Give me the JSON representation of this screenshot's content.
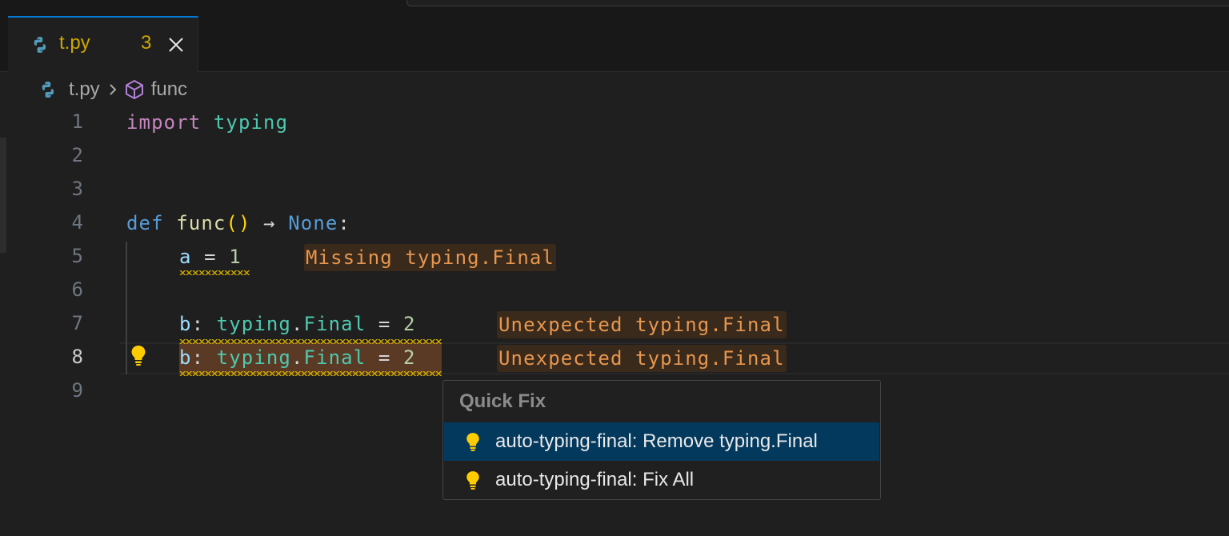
{
  "tab": {
    "filename": "t.py",
    "problem_count": "3"
  },
  "breadcrumb": {
    "file": "t.py",
    "symbol": "func"
  },
  "gutter": {
    "lines": [
      "1",
      "2",
      "3",
      "4",
      "5",
      "6",
      "7",
      "8",
      "9"
    ],
    "active_line": "8"
  },
  "code": {
    "line1": {
      "kw": "import",
      "module": "typing"
    },
    "line4": {
      "kw": "def",
      "name": "func",
      "parens": "()",
      "arrow": "→",
      "ret": "None",
      "colon": ":"
    },
    "line5": {
      "var": "a",
      "eq": " = ",
      "value": "1"
    },
    "line7": {
      "var": "b",
      "colon": ": ",
      "module": "typing",
      "dot": ".",
      "type": "Final",
      "eq": " = ",
      "value": "2"
    },
    "line8": {
      "var": "b",
      "colon": ": ",
      "module": "typing",
      "dot": ".",
      "type": "Final",
      "eq": " = ",
      "value": "2"
    }
  },
  "diagnostics": {
    "line5": "Missing typing.Final",
    "line7": "Unexpected typing.Final",
    "line8": "Unexpected typing.Final"
  },
  "quick_fix": {
    "title": "Quick Fix",
    "items": [
      {
        "label": "auto-typing-final: Remove typing.Final",
        "selected": true,
        "icon": "lightbulb-icon"
      },
      {
        "label": "auto-typing-final: Fix All",
        "selected": false,
        "icon": "lightbulb-icon"
      }
    ]
  },
  "colors": {
    "warning": "#cca700",
    "accent": "#0078d4",
    "selection": "#04395e",
    "inlay_text": "#e6964e"
  }
}
